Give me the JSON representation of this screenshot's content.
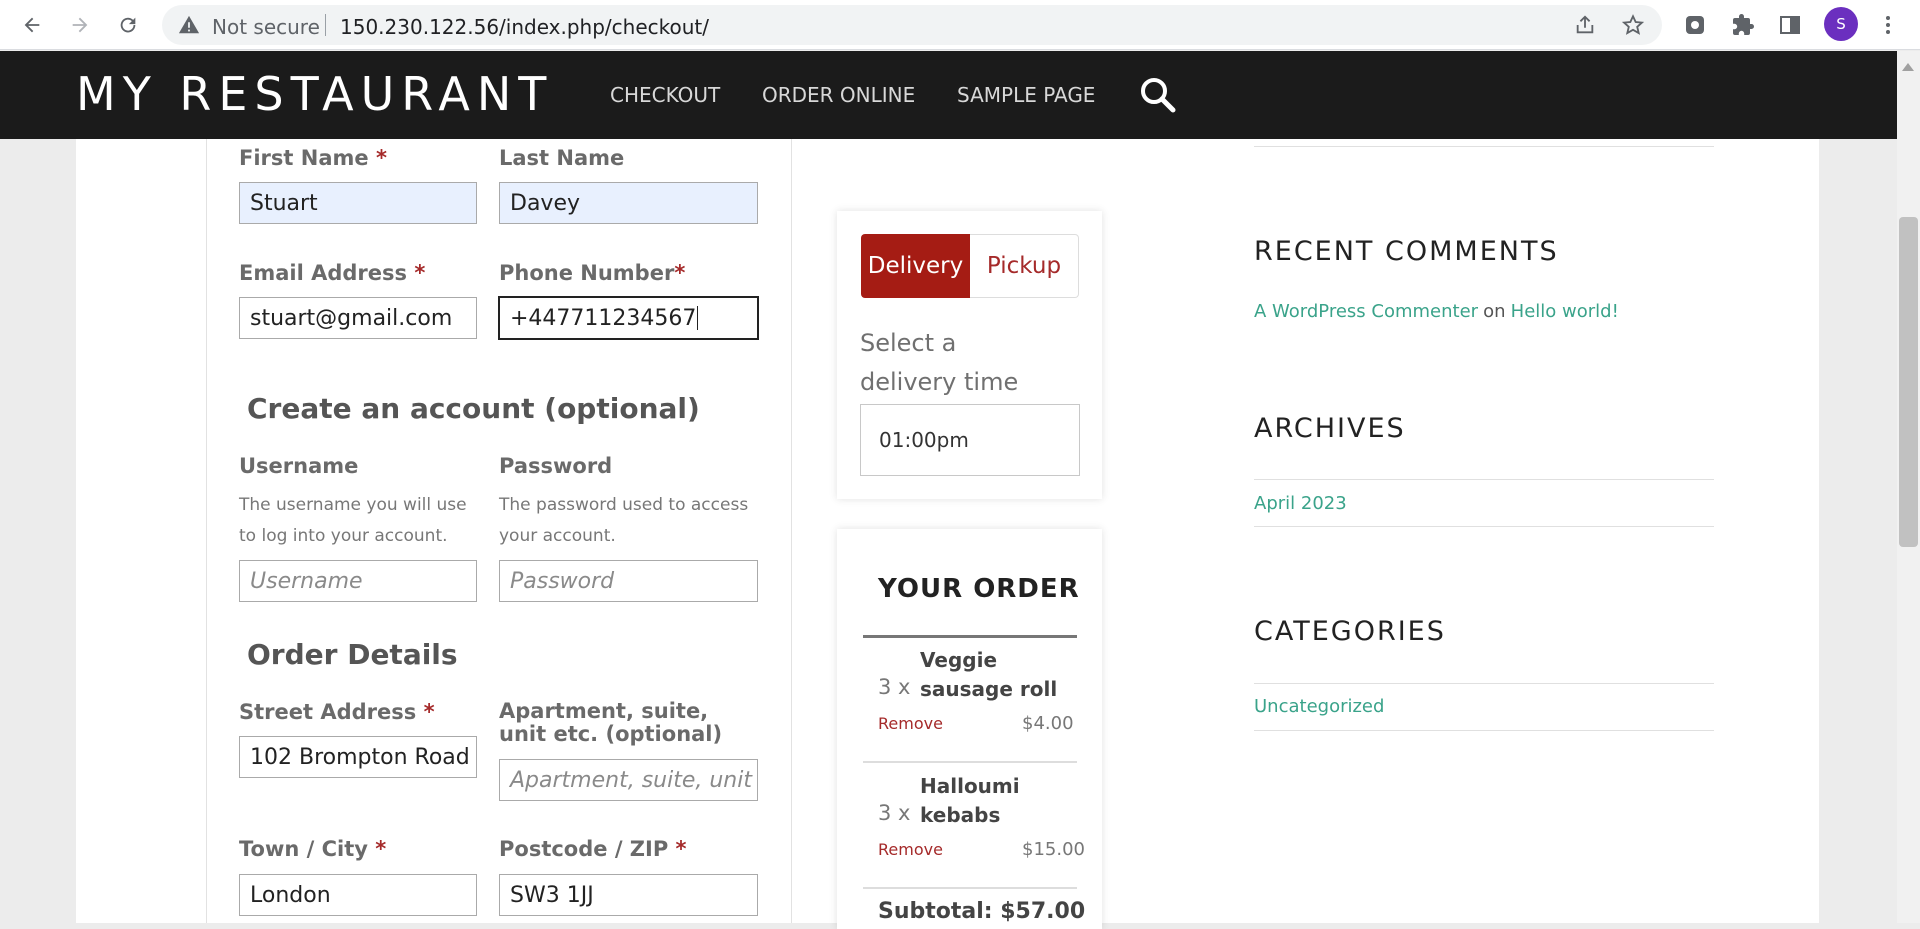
{
  "browser": {
    "security_label": "Not secure",
    "url": "150.230.122.56/index.php/checkout/",
    "profile_initial": "S"
  },
  "site": {
    "title": "MY RESTAURANT",
    "menu": [
      "CHECKOUT",
      "ORDER ONLINE",
      "SAMPLE PAGE"
    ]
  },
  "form": {
    "first_name": {
      "label": "First Name",
      "required": "*",
      "value": "Stuart"
    },
    "last_name": {
      "label": "Last Name",
      "value": "Davey"
    },
    "email": {
      "label": "Email Address",
      "required": "*",
      "value": "stuart@gmail.com"
    },
    "phone": {
      "label": "Phone Number",
      "required": "*",
      "value": "+447711234567"
    },
    "account_section": "Create an account (optional)",
    "username": {
      "label": "Username",
      "help": "The username you will use to log into your account.",
      "placeholder": "Username"
    },
    "password": {
      "label": "Password",
      "help": "The password used to access your account.",
      "placeholder": "Password"
    },
    "order_section": "Order Details",
    "street": {
      "label": "Street Address",
      "required": "*",
      "value": "102 Brompton Road"
    },
    "apartment": {
      "label": "Apartment, suite, unit etc. (optional)",
      "placeholder": "Apartment, suite, unit"
    },
    "city": {
      "label": "Town / City",
      "required": "*",
      "value": "London"
    },
    "postcode": {
      "label": "Postcode / ZIP",
      "required": "*",
      "value": "SW3 1JJ"
    }
  },
  "delivery": {
    "delivery_label": "Delivery",
    "pickup_label": "Pickup",
    "select_label": "Select a delivery time",
    "time_value": "01:00pm"
  },
  "order": {
    "title": "YOUR ORDER",
    "items": [
      {
        "qty": "3 x",
        "name": "Veggie sausage roll",
        "remove": "Remove",
        "price": "$4.00"
      },
      {
        "qty": "3 x",
        "name": "Halloumi kebabs",
        "remove": "Remove",
        "price": "$15.00"
      }
    ],
    "subtotal": "Subtotal:  $57.00"
  },
  "sidebar": {
    "recent_comments_title": "RECENT COMMENTS",
    "comment_author": "A WordPress Commenter",
    "comment_on": "on",
    "comment_post": "Hello world!",
    "archives_title": "ARCHIVES",
    "archive_item": "April 2023",
    "categories_title": "CATEGORIES",
    "category_item": "Uncategorized"
  },
  "colors": {
    "accent": "#a51c14",
    "link": "#3aa38a",
    "header_bg": "#1b1b1b"
  }
}
